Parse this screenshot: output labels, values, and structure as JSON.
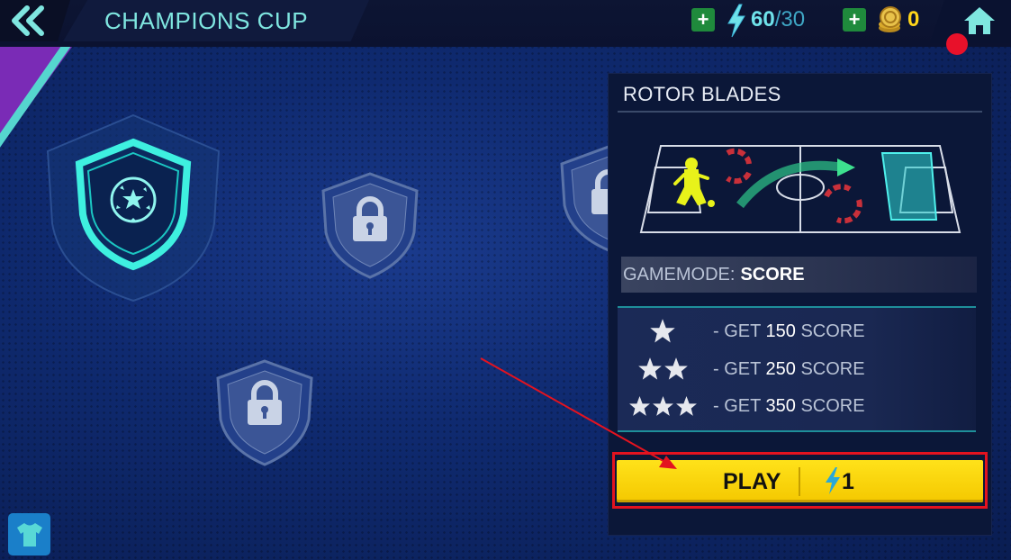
{
  "header": {
    "title": "CHAMPIONS CUP",
    "energy_current": "60",
    "energy_separator": "/",
    "energy_max": "30",
    "coins": "0"
  },
  "level_card": {
    "title": "ROTOR BLADES",
    "gamemode_label": "GAMEMODE:",
    "gamemode_value": "SCORE",
    "goals": [
      {
        "stars": 1,
        "prefix": "- GET",
        "amount": "150",
        "suffix": "SCORE"
      },
      {
        "stars": 2,
        "prefix": "- GET",
        "amount": "250",
        "suffix": "SCORE"
      },
      {
        "stars": 3,
        "prefix": "- GET",
        "amount": "350",
        "suffix": "SCORE"
      }
    ],
    "play_label": "PLAY",
    "play_cost": "1"
  },
  "colors": {
    "accent_teal": "#7fe6e0",
    "play_yellow": "#ffe21a",
    "plus_green": "#1f8a3c",
    "coin_gold": "#ffd51a",
    "highlight_red": "#e3131f"
  },
  "icons": {
    "back": "double-chevron-left-icon",
    "energy": "lightning-bolt-icon",
    "coin": "coin-stack-icon",
    "home": "home-icon",
    "lock": "padlock-icon",
    "ball": "soccer-ball-icon",
    "shirt": "jersey-icon",
    "star": "star-icon"
  }
}
